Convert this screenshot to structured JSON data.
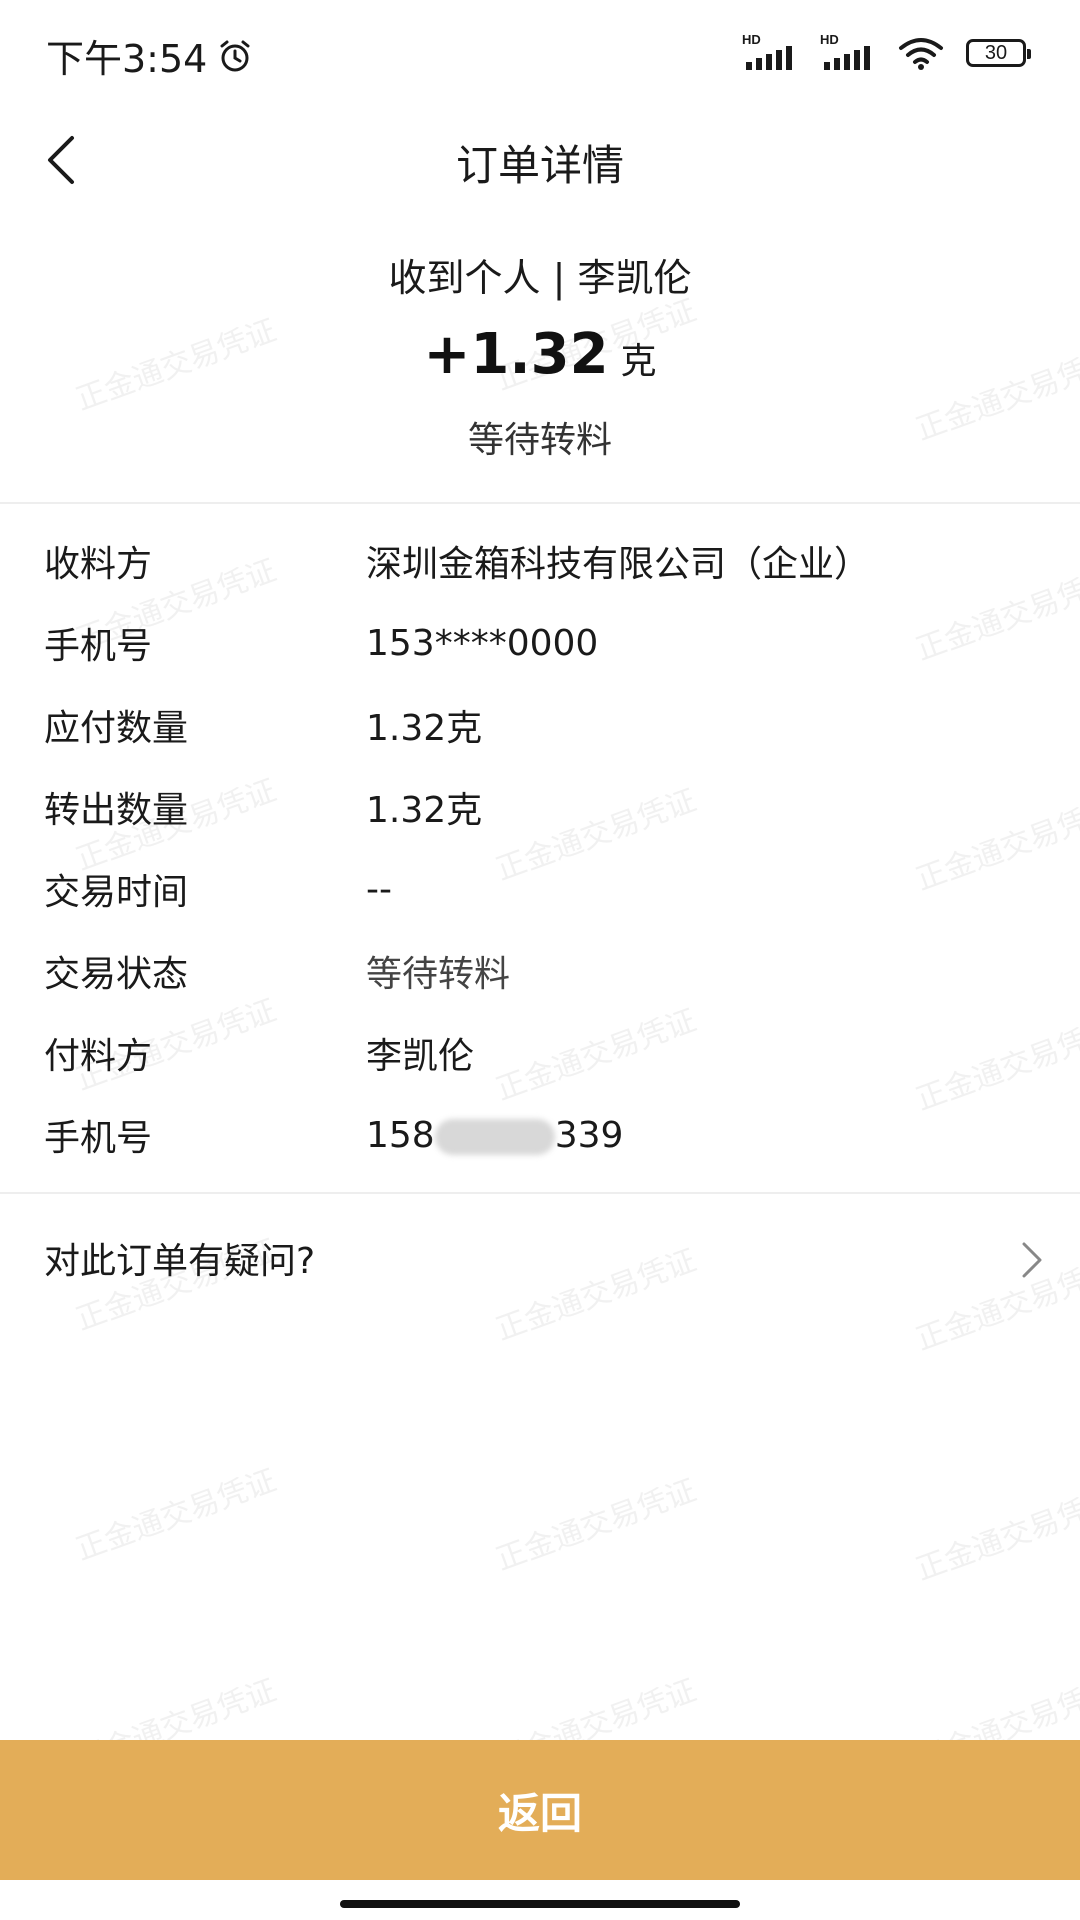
{
  "status_bar": {
    "time": "下午3:54",
    "hd_label_1": "HD",
    "hd_label_2": "HD",
    "battery": "30",
    "icons": [
      "alarm-icon",
      "signal-icon",
      "signal-icon",
      "wifi-icon",
      "battery-icon"
    ]
  },
  "header": {
    "title": "订单详情",
    "back_icon": "chevron-left-icon"
  },
  "summary": {
    "party": "收到个人 | 李凯伦",
    "amount": "+1.32",
    "unit": "克",
    "status": "等待转料"
  },
  "details": [
    {
      "label": "收料方",
      "value": "深圳金箱科技有限公司（企业）"
    },
    {
      "label": "手机号",
      "value": "153****0000"
    },
    {
      "label": "应付数量",
      "value": "1.32克"
    },
    {
      "label": "转出数量",
      "value": "1.32克"
    },
    {
      "label": "交易时间",
      "value": "--"
    },
    {
      "label": "交易状态",
      "value": "等待转料"
    },
    {
      "label": "付料方",
      "value": "李凯伦"
    },
    {
      "label": "手机号",
      "value_prefix": "158",
      "value_suffix": "339"
    }
  ],
  "question": {
    "text": "对此订单有疑问?",
    "icon": "chevron-right-icon"
  },
  "watermark_text": "正金通交易凭证",
  "bottom_button": {
    "label": "返回"
  },
  "colors": {
    "accent": "#e3ad58",
    "text": "#1a1a1a",
    "divider": "#eeeeee"
  }
}
